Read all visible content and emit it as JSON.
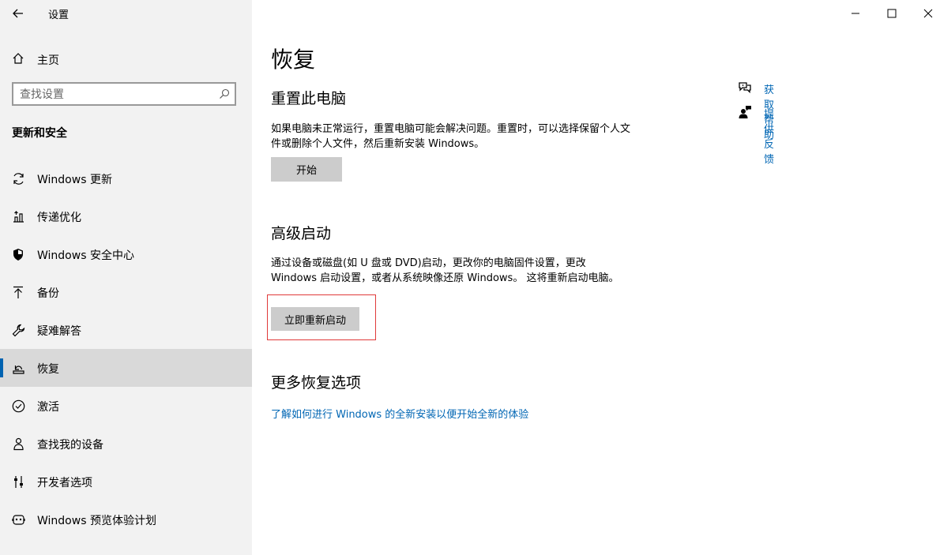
{
  "window": {
    "title": "设置"
  },
  "sidebar": {
    "home_label": "主页",
    "search_placeholder": "查找设置",
    "section_heading": "更新和安全",
    "items": [
      {
        "label": "Windows 更新",
        "icon": "sync-icon"
      },
      {
        "label": "传递优化",
        "icon": "delivery-optimization-icon"
      },
      {
        "label": "Windows 安全中心",
        "icon": "shield-icon"
      },
      {
        "label": "备份",
        "icon": "upload-arrow-icon"
      },
      {
        "label": "疑难解答",
        "icon": "wrench-icon"
      },
      {
        "label": "恢复",
        "icon": "recovery-icon",
        "selected": true
      },
      {
        "label": "激活",
        "icon": "check-circle-icon"
      },
      {
        "label": "查找我的设备",
        "icon": "person-pin-icon"
      },
      {
        "label": "开发者选项",
        "icon": "developer-sliders-icon"
      },
      {
        "label": "Windows 预览体验计划",
        "icon": "insider-icon"
      }
    ]
  },
  "main": {
    "page_title": "恢复",
    "reset": {
      "heading": "重置此电脑",
      "description": "如果电脑未正常运行，重置电脑可能会解决问题。重置时，可以选择保留个人文件或删除个人文件，然后重新安装 Windows。",
      "button_label": "开始"
    },
    "advanced": {
      "heading": "高级启动",
      "description": "通过设备或磁盘(如 U 盘或 DVD)启动，更改你的电脑固件设置，更改 Windows 启动设置，或者从系统映像还原 Windows。 这将重新启动电脑。",
      "button_label": "立即重新启动"
    },
    "more": {
      "heading": "更多恢复选项",
      "link_label": "了解如何进行 Windows 的全新安装以便开始全新的体验"
    }
  },
  "help": {
    "get_help": "获取帮助",
    "feedback": "提供反馈"
  },
  "colors": {
    "sidebar_bg": "#f2f2f2",
    "selected_bg": "#d9d9d9",
    "accent": "#0063b1",
    "link": "#0066b4",
    "button_bg": "#cccccc",
    "highlight": "#e03a3a"
  }
}
